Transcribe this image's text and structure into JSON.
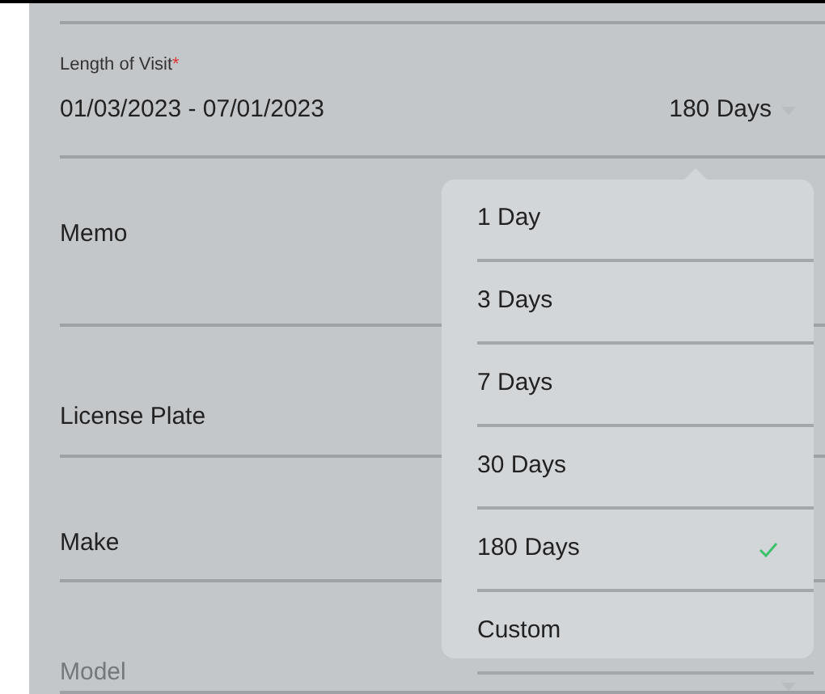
{
  "length_of_visit": {
    "label": "Length of Visit",
    "required": true,
    "required_mark": "*",
    "value": "01/03/2023 - 07/01/2023",
    "duration": "180 Days"
  },
  "fields": [
    {
      "label": "Memo",
      "disabled": false
    },
    {
      "label": "License Plate",
      "disabled": false
    },
    {
      "label": "Make",
      "disabled": false
    },
    {
      "label": "Model",
      "disabled": true
    }
  ],
  "duration_menu": [
    {
      "label": "1 Day",
      "selected": false
    },
    {
      "label": "3 Days",
      "selected": false
    },
    {
      "label": "7 Days",
      "selected": false
    },
    {
      "label": "30 Days",
      "selected": false
    },
    {
      "label": "180 Days",
      "selected": true
    },
    {
      "label": "Custom",
      "selected": false
    }
  ]
}
